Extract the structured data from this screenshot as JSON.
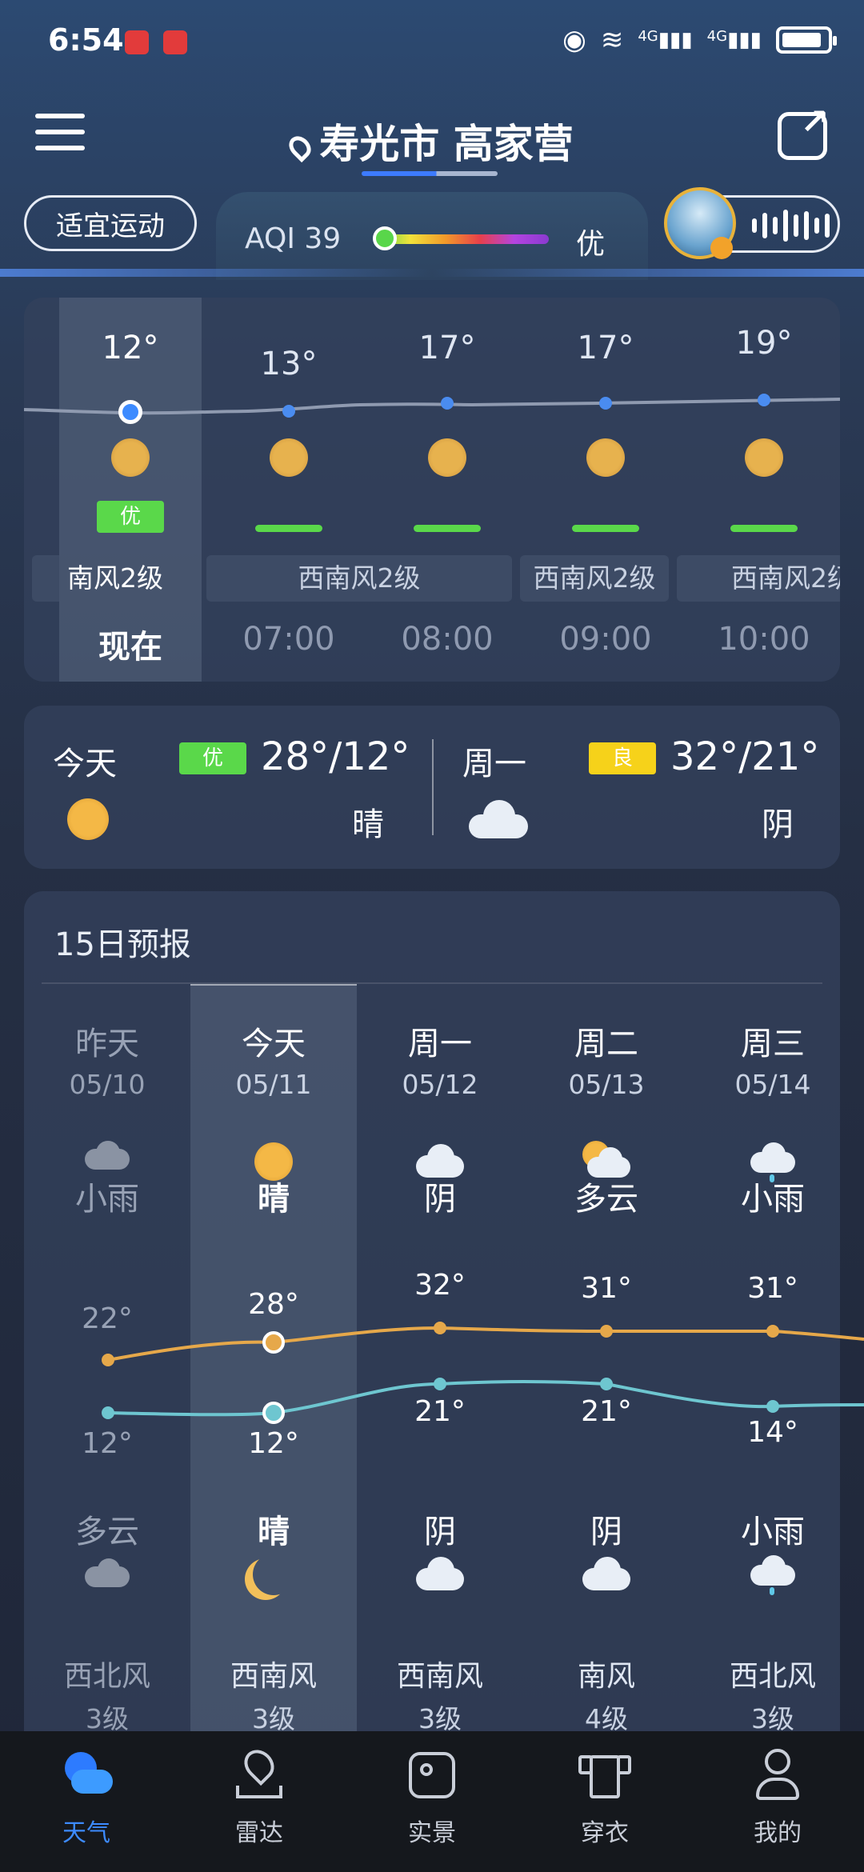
{
  "status_bar": {
    "time": "6:54",
    "network_1": "4G",
    "network_2": "4G"
  },
  "header": {
    "location": "寿光市 高家营",
    "sport_pill": "适宜运动",
    "aqi_label": "AQI 39",
    "aqi_level": "优",
    "aqi_fraction": 0.08
  },
  "hourly": {
    "items": [
      {
        "temp": "12°",
        "time": "现在",
        "aqi": "优"
      },
      {
        "temp": "13°",
        "time": "07:00"
      },
      {
        "temp": "17°",
        "time": "08:00"
      },
      {
        "temp": "17°",
        "time": "09:00"
      },
      {
        "temp": "19°",
        "time": "10:00"
      }
    ],
    "winds": [
      "南风2级",
      "西南风2级",
      "西南风2级",
      "西南风2级"
    ]
  },
  "today_tomorrow": {
    "today": {
      "label": "今天",
      "aqi": "优",
      "temp": "28°/12°",
      "cond": "晴"
    },
    "tomorrow": {
      "label": "周一",
      "aqi": "良",
      "temp": "32°/21°",
      "cond": "阴"
    }
  },
  "forecast": {
    "title": "15日预报",
    "days": [
      {
        "day": "昨天",
        "date": "05/10",
        "cond": "小雨",
        "high": "22°",
        "low": "12°",
        "night_cond": "多云",
        "wind": "西北风",
        "wind_level": "3级"
      },
      {
        "day": "今天",
        "date": "05/11",
        "cond": "晴",
        "high": "28°",
        "low": "12°",
        "night_cond": "晴",
        "wind": "西南风",
        "wind_level": "3级"
      },
      {
        "day": "周一",
        "date": "05/12",
        "cond": "阴",
        "high": "32°",
        "low": "21°",
        "night_cond": "阴",
        "wind": "西南风",
        "wind_level": "3级"
      },
      {
        "day": "周二",
        "date": "05/13",
        "cond": "多云",
        "high": "31°",
        "low": "21°",
        "night_cond": "阴",
        "wind": "南风",
        "wind_level": "4级"
      },
      {
        "day": "周三",
        "date": "05/14",
        "cond": "小雨",
        "high": "31°",
        "low": "14°",
        "night_cond": "小雨",
        "wind": "西北风",
        "wind_level": "3级"
      }
    ]
  },
  "nav": {
    "items": [
      {
        "label": "天气",
        "icon": "weather-icon"
      },
      {
        "label": "雷达",
        "icon": "radar-icon"
      },
      {
        "label": "实景",
        "icon": "live-view-icon"
      },
      {
        "label": "穿衣",
        "icon": "clothing-icon"
      },
      {
        "label": "我的",
        "icon": "profile-icon"
      }
    ],
    "active": "天气"
  },
  "colors": {
    "aqi_good": "#5ad84a",
    "aqi_moderate": "#f6d21a",
    "high_line": "#e6a84a",
    "low_line": "#6ec6d0",
    "accent": "#3d8bff"
  }
}
